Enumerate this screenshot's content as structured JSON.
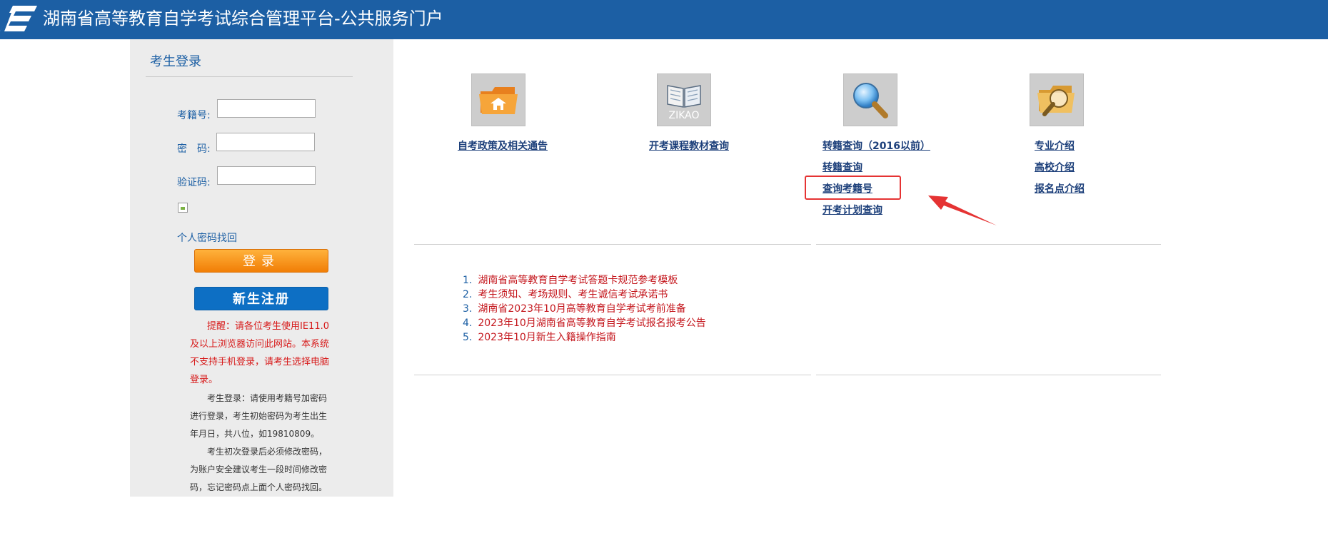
{
  "header": {
    "title": "湖南省高等教育自学考试综合管理平台-公共服务门户",
    "bg_color": "#1c5fa4"
  },
  "login": {
    "title": "考生登录",
    "exam_no_label": "考籍号:",
    "password_label": "密　码:",
    "captcha_label": "验证码:",
    "exam_no_value": "",
    "password_value": "",
    "captcha_value": "",
    "forgot_password": "个人密码找回",
    "login_button": "登录",
    "register_button": "新生注册",
    "notice_red": "提醒：请各位考生使用IE11.0及以上浏览器访问此网站。本系统不支持手机登录，请考生选择电脑登录。",
    "notice_1": "考生登录：请使用考籍号加密码进行登录，考生初始密码为考生出生年月日，共八位，如19810809。",
    "notice_2": "考生初次登录后必须修改密码，为账户安全建议考生一段时间修改密码，忘记密码点上面个人密码找回。"
  },
  "quick_links": {
    "policy": "自考政策及相关通告",
    "course_query": "开考课程教材查询",
    "zikao_tile_text": "ZIKAO",
    "transfer_before_2016": "转籍查询（2016以前）",
    "transfer": "转籍查询",
    "query_exam_no": "查询考籍号",
    "plan_query": "开考计划查询",
    "major_intro": "专业介绍",
    "college_intro": "高校介绍",
    "registration_intro": "报名点介绍"
  },
  "news": [
    {
      "num": "1.",
      "text": "湖南省高等教育自学考试答题卡规范参考模板"
    },
    {
      "num": "2.",
      "text": "考生须知、考场规则、考生诚信考试承诺书"
    },
    {
      "num": "3.",
      "text": "湖南省2023年10月高等教育自学考试考前准备"
    },
    {
      "num": "4.",
      "text": "2023年10月湖南省高等教育自学考试报名报考公告"
    },
    {
      "num": "5.",
      "text": "2023年10月新生入籍操作指南"
    }
  ],
  "icons": {
    "logo": "logo-icon",
    "folder": "folder-home-icon",
    "book": "book-icon",
    "search": "magnifier-icon",
    "folder_search": "folder-search-icon"
  },
  "colors": {
    "accent": "#1c5fa4",
    "highlight": "#e53333",
    "news_red": "#c4161c"
  }
}
